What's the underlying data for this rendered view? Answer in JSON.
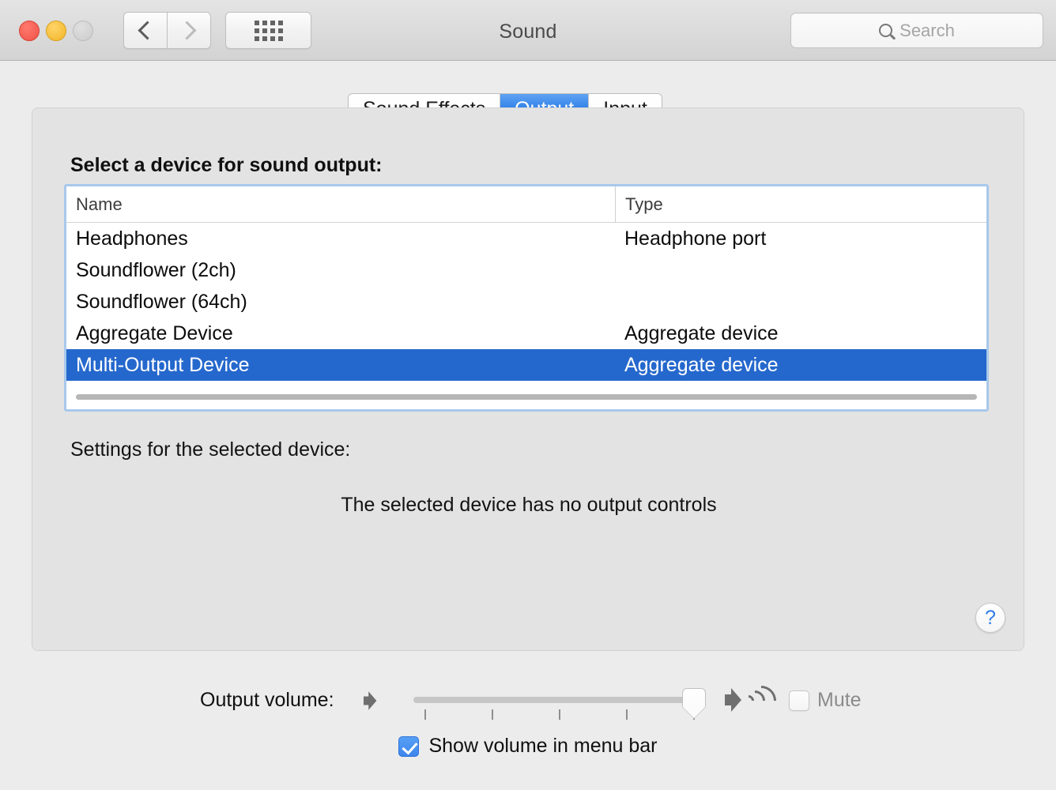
{
  "window": {
    "title": "Sound",
    "traffic_lights": [
      "close",
      "minimize",
      "zoom"
    ],
    "nav_back_icon": "chevron-left-icon",
    "nav_forward_icon": "chevron-right-icon",
    "show_all_icon": "grid-dots-icon"
  },
  "search": {
    "icon": "search-icon",
    "placeholder": "Search",
    "value": ""
  },
  "tabs": [
    {
      "label": "Sound Effects",
      "selected": false
    },
    {
      "label": "Output",
      "selected": true
    },
    {
      "label": "Input",
      "selected": false
    }
  ],
  "panel": {
    "section_label": "Select a device for sound output:",
    "settings_label": "Settings for the selected device:",
    "no_controls_message": "The selected device has no output controls",
    "help_button_label": "?"
  },
  "device_table": {
    "columns": [
      "Name",
      "Type"
    ],
    "rows": [
      {
        "name": "Headphones",
        "type": "Headphone port",
        "selected": false
      },
      {
        "name": "Soundflower (2ch)",
        "type": "",
        "selected": false
      },
      {
        "name": "Soundflower (64ch)",
        "type": "",
        "selected": false
      },
      {
        "name": "Aggregate Device",
        "type": "Aggregate device",
        "selected": false
      },
      {
        "name": "Multi-Output Device",
        "type": "Aggregate device",
        "selected": true
      }
    ],
    "has_horizontal_scrollbar": true
  },
  "volume": {
    "label": "Output volume:",
    "low_icon": "speaker-low-icon",
    "high_icon": "speaker-high-icon",
    "slider_value_percent": 95,
    "tick_count": 5,
    "mute": {
      "label": "Mute",
      "checked": false,
      "disabled": true
    }
  },
  "menubar_option": {
    "label": "Show volume in menu bar",
    "checked": true
  },
  "colors": {
    "accent_blue": "#2568cd",
    "tab_selected_blue": "#2f7fe8",
    "focus_ring": "#a8c8ec",
    "window_bg": "#ececec",
    "panel_bg": "#e3e3e3",
    "help_blue": "#2f7ce8",
    "disabled_text": "#8b8b8b"
  }
}
